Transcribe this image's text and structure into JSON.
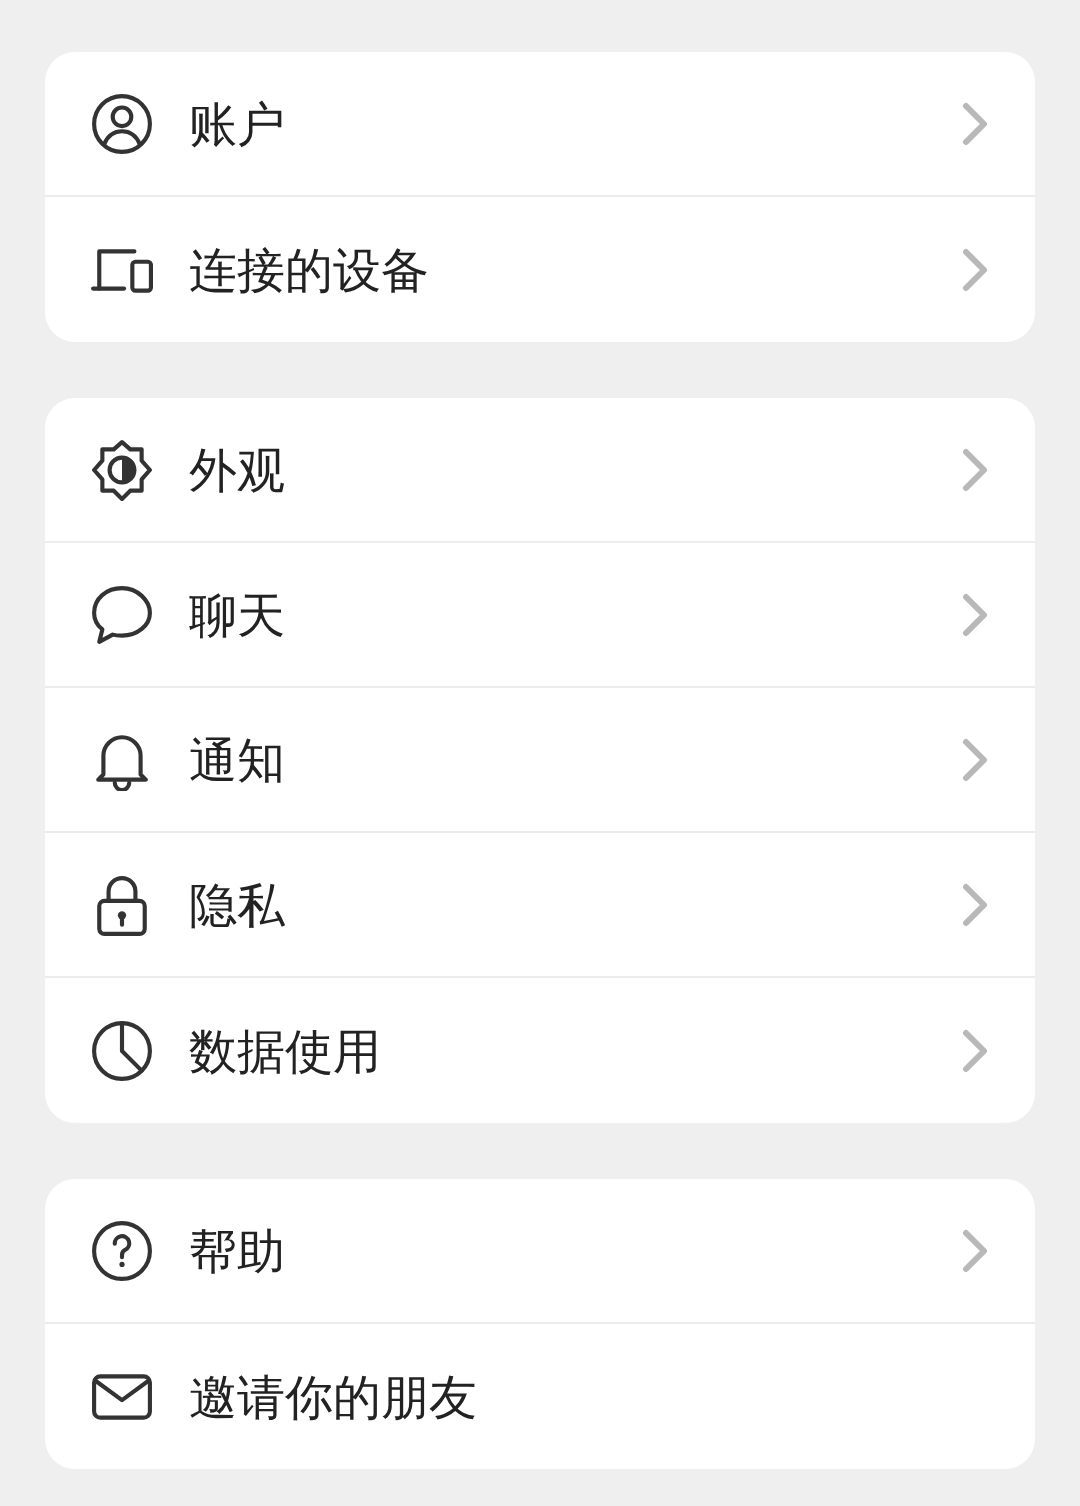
{
  "groups": [
    {
      "items": [
        {
          "label": "账户",
          "chevron": true
        },
        {
          "label": "连接的设备",
          "chevron": true
        }
      ]
    },
    {
      "items": [
        {
          "label": "外观",
          "chevron": true
        },
        {
          "label": "聊天",
          "chevron": true
        },
        {
          "label": "通知",
          "chevron": true
        },
        {
          "label": "隐私",
          "chevron": true
        },
        {
          "label": "数据使用",
          "chevron": true
        }
      ]
    },
    {
      "items": [
        {
          "label": "帮助",
          "chevron": true
        },
        {
          "label": "邀请你的朋友",
          "chevron": false
        }
      ]
    }
  ]
}
